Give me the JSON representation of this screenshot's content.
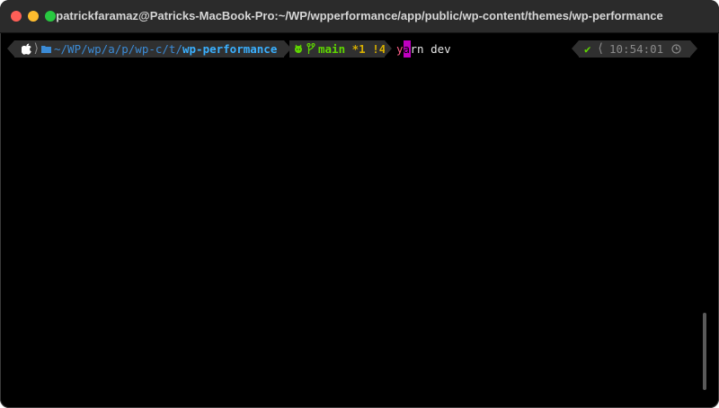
{
  "window": {
    "title": "patrickfaramaz@Patricks-MacBook-Pro:~/WP/wpperformance/app/public/wp-content/themes/wp-performance"
  },
  "prompt": {
    "path_prefix": "~/WP/wp/a/p/wp-c/t/",
    "path_current": "wp-performance",
    "branch": "main",
    "staged": "*1",
    "modified": "!4",
    "command_first_char": "y",
    "command_cursor_char": "a",
    "command_rest": "rn dev",
    "status_check": "✔",
    "time": "10:54:01"
  },
  "colors": {
    "background": "#000000",
    "path": "#3ab0ff",
    "branch": "#5fd700",
    "status": "#d7af00",
    "cursor": "#c000c0"
  },
  "icons": [
    "apple-icon",
    "folder-icon",
    "github-icon",
    "branch-icon",
    "check-icon",
    "clock-icon"
  ]
}
